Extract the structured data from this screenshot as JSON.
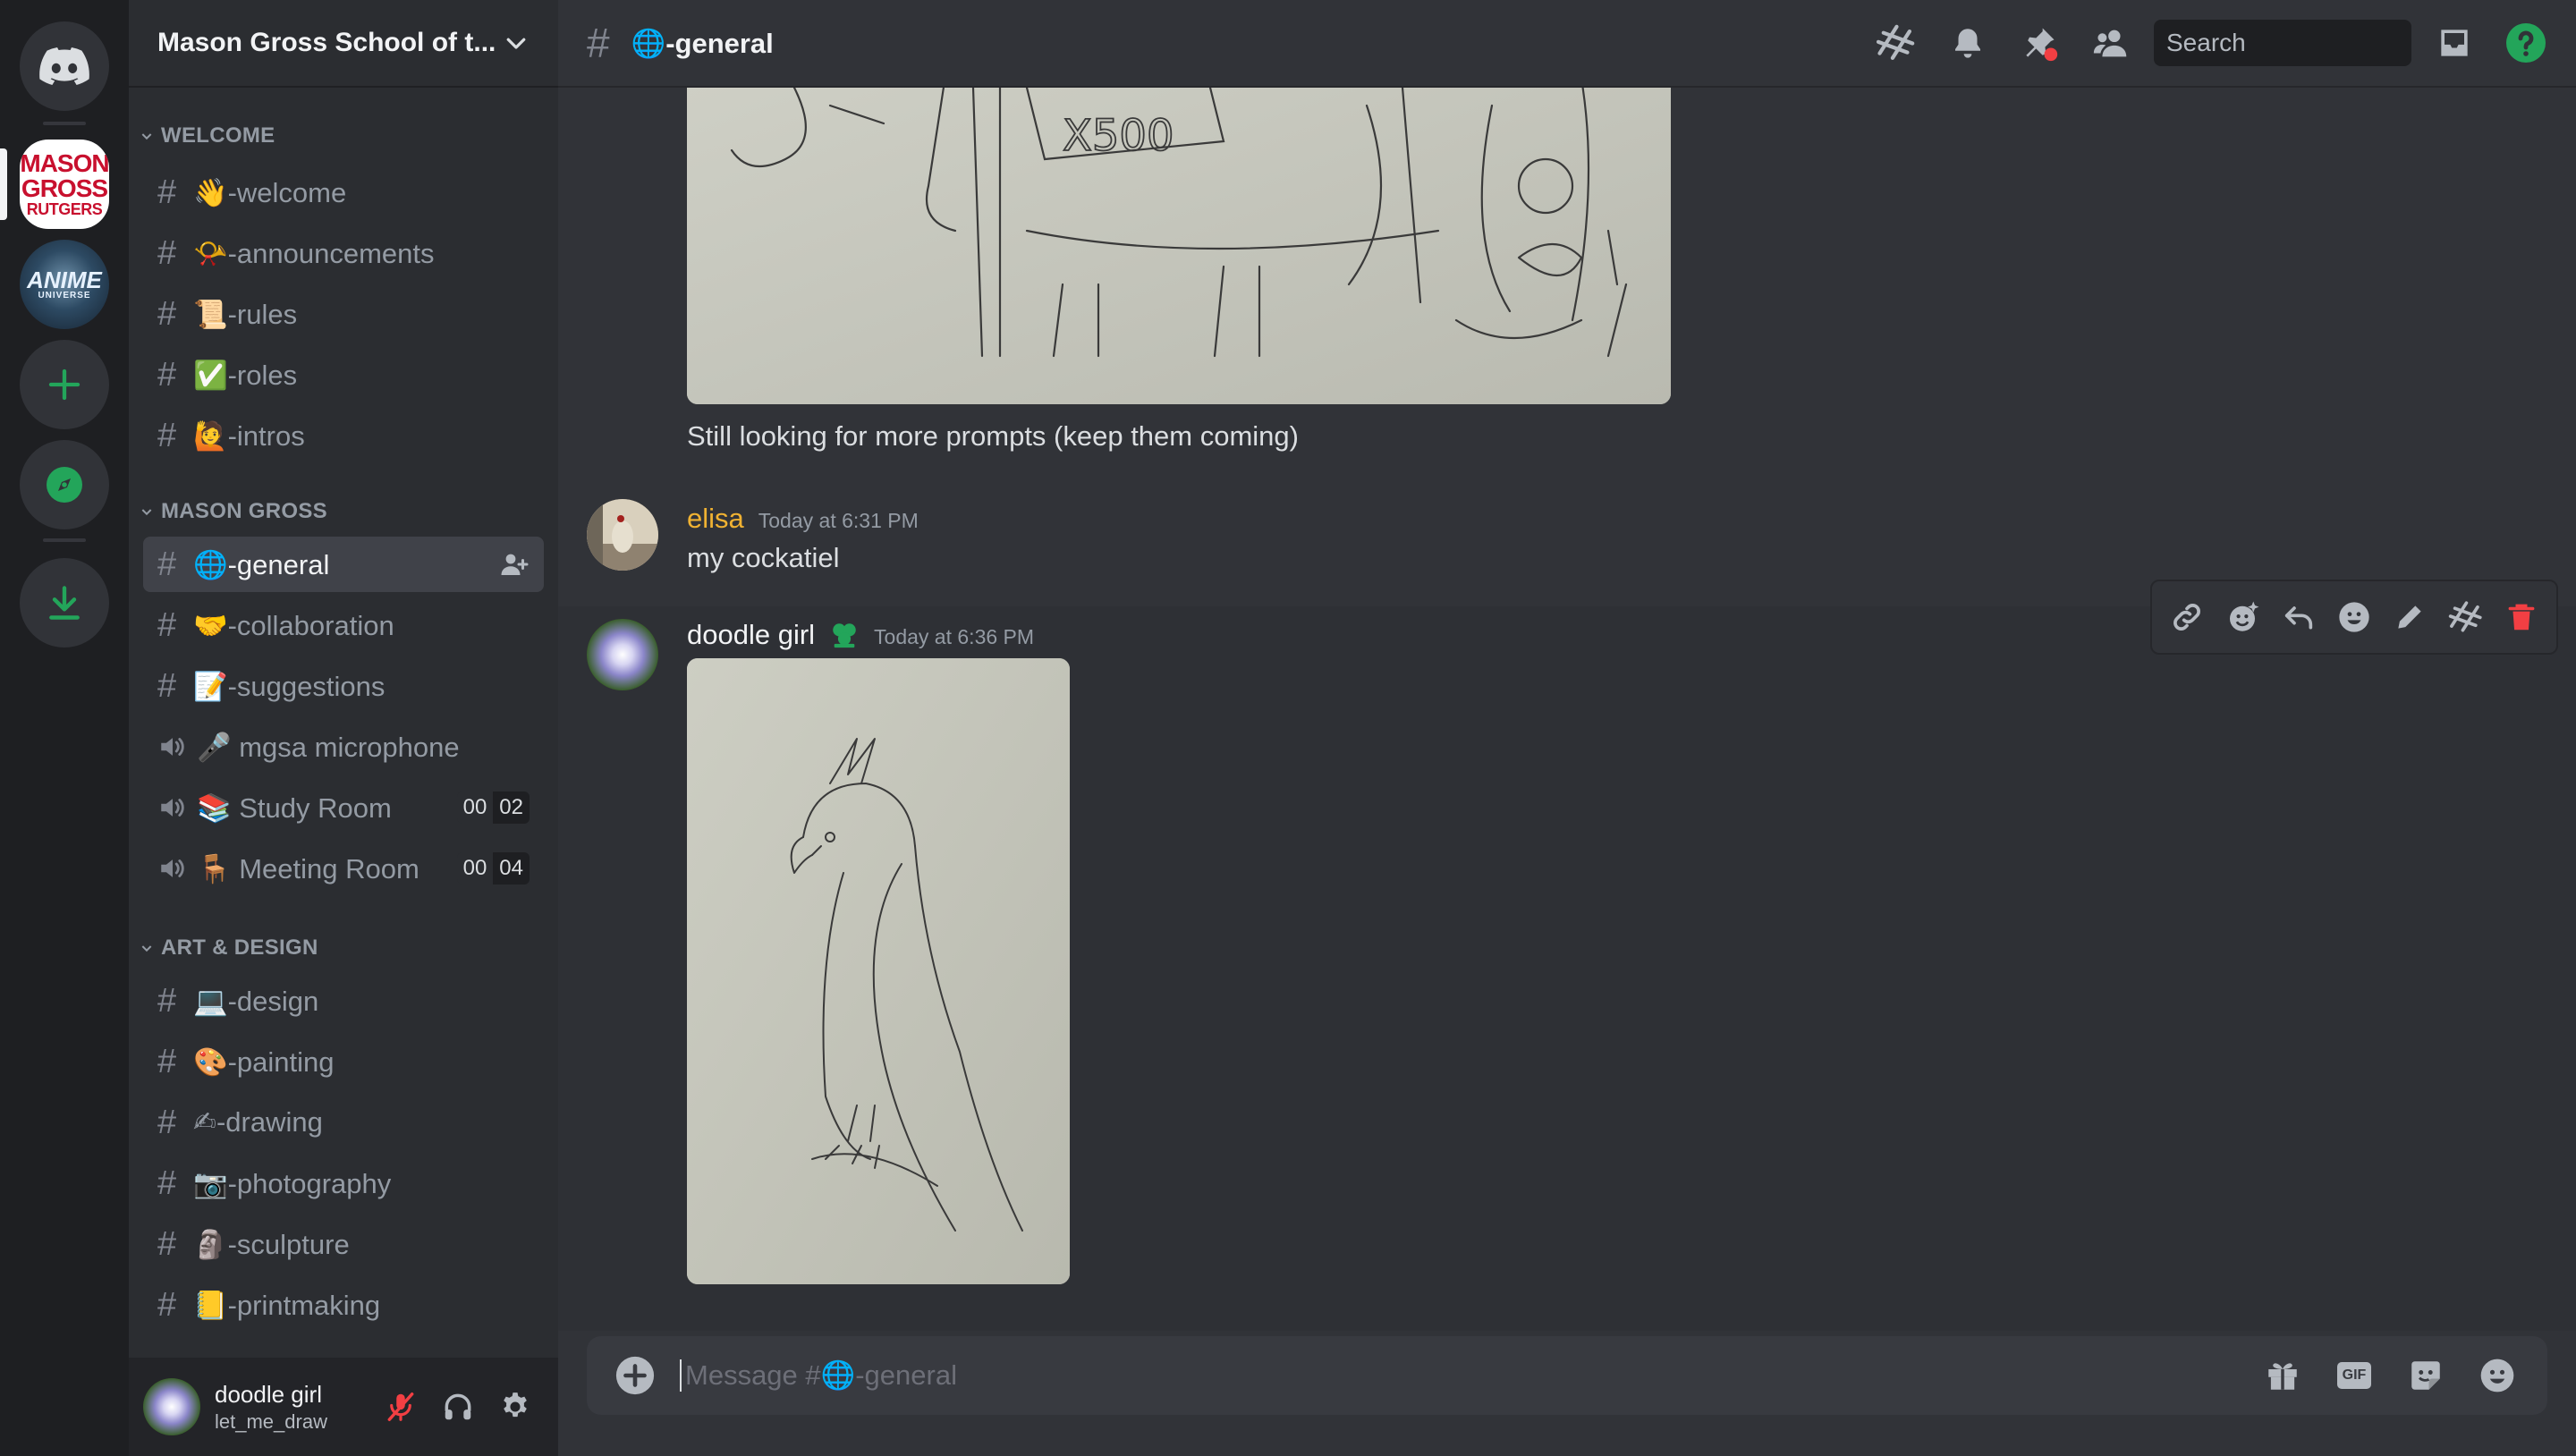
{
  "app": {
    "name": "Discord"
  },
  "servers": {
    "home_icon": "discord-logo-icon",
    "mason_logo": {
      "line1": "MASON",
      "line2": "GROSS",
      "line3": "RUTGERS"
    },
    "anime_logo": {
      "line1": "ANIME",
      "line2": "UNIVERSE"
    },
    "add_icon": "plus-icon",
    "explore_icon": "compass-icon",
    "download_icon": "download-icon"
  },
  "sidebar": {
    "server_name": "Mason Gross School of t...",
    "categories": [
      {
        "label": "WELCOME"
      },
      {
        "label": "MASON GROSS"
      },
      {
        "label": "ART & DESIGN"
      }
    ],
    "channels": [
      {
        "name": "👋-welcome",
        "type": "text"
      },
      {
        "name": "📯-announcements",
        "type": "text"
      },
      {
        "name": "📜-rules",
        "type": "text"
      },
      {
        "name": "✅-roles",
        "type": "text"
      },
      {
        "name": "🙋-intros",
        "type": "text"
      },
      {
        "name": "🌐-general",
        "type": "text",
        "active": true
      },
      {
        "name": "🤝-collaboration",
        "type": "text"
      },
      {
        "name": "📝-suggestions",
        "type": "text"
      },
      {
        "name": "🎤 mgsa microphone",
        "type": "voice"
      },
      {
        "name": "📚 Study Room",
        "type": "voice",
        "count_a": "00",
        "count_b": "02"
      },
      {
        "name": "🪑 Meeting Room",
        "type": "voice",
        "count_a": "00",
        "count_b": "04"
      },
      {
        "name": "💻-design",
        "type": "text"
      },
      {
        "name": "🎨-painting",
        "type": "text"
      },
      {
        "name": "✍-drawing",
        "type": "text"
      },
      {
        "name": "📷-photography",
        "type": "text"
      },
      {
        "name": "🗿-sculpture",
        "type": "text"
      },
      {
        "name": "📒-printmaking",
        "type": "text"
      }
    ],
    "user": {
      "display_name": "doodle girl",
      "username": "let_me_draw"
    }
  },
  "header": {
    "channel_title": "🌐-general",
    "search_placeholder": "Search"
  },
  "messages": [
    {
      "text": "Still looking for more prompts (keep them coming)"
    },
    {
      "author": "elisa",
      "author_color": "#f0b232",
      "timestamp": "Today at 6:31 PM",
      "text": "my cockatiel"
    },
    {
      "author": "doodle girl",
      "author_color": "#f2f3f5",
      "timestamp": "Today at 6:36 PM",
      "text": ""
    }
  ],
  "top_image_text": "X500",
  "composer": {
    "placeholder": "Message #🌐-general",
    "gif_label": "GIF"
  },
  "colors": {
    "accent_green": "#23a55a",
    "danger_red": "#f23f43",
    "background": "#313338"
  }
}
